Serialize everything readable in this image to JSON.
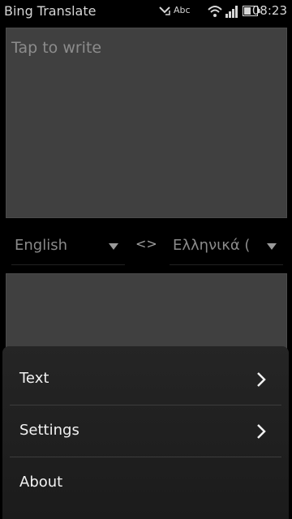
{
  "statusbar": {
    "app_title": "Bing Translate",
    "network_label": "Abc",
    "clock": "08:23",
    "icons": [
      "missed-call-icon",
      "wifi-icon",
      "signal-icon",
      "battery-icon"
    ]
  },
  "input": {
    "placeholder": "Tap to write"
  },
  "languages": {
    "from": "English",
    "swap": "<>",
    "to": "Ελληνικά ("
  },
  "menu": {
    "items": [
      {
        "label": "Text",
        "has_submenu": true
      },
      {
        "label": "Settings",
        "has_submenu": true
      },
      {
        "label": "About",
        "has_submenu": false
      }
    ]
  },
  "colors": {
    "background": "#000000",
    "text_area": "#404040",
    "menu": "#222222"
  }
}
